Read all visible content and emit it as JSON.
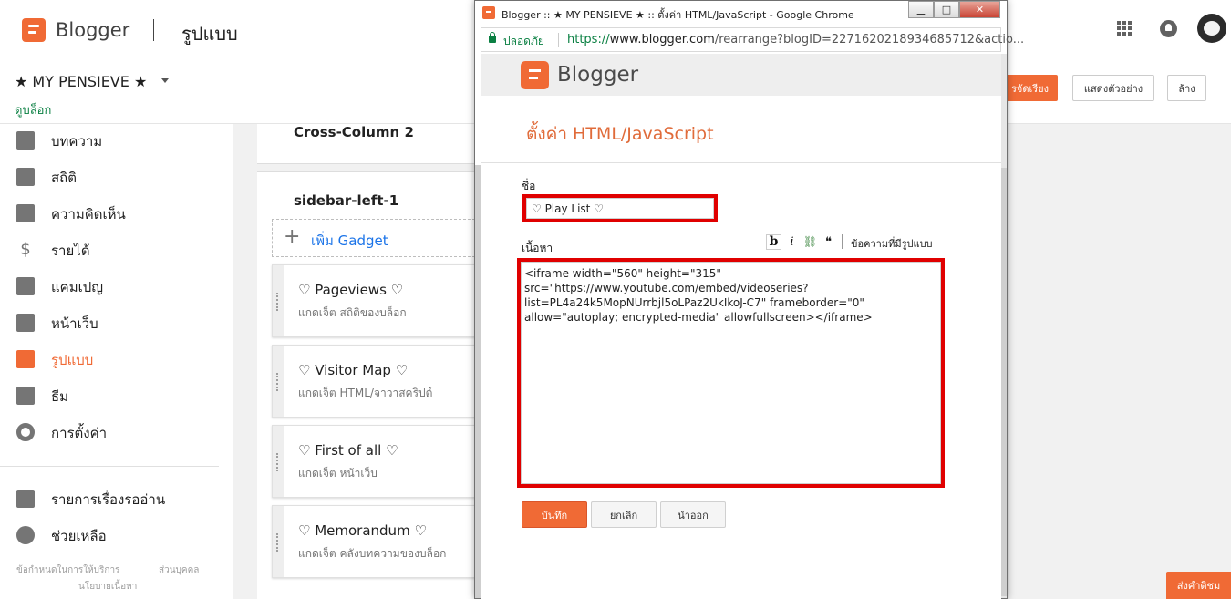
{
  "topbar": {
    "brand": "Blogger",
    "section": "รูปแบบ"
  },
  "blog": {
    "name": "★ MY PENSIEVE ★",
    "view_blog": "ดูบล็อก",
    "arrange_button": "รจัดเรียง",
    "preview_button": "แสดงตัวอย่าง",
    "clear_button": "ล้าง"
  },
  "sidebar": {
    "items": [
      {
        "label": "บทความ",
        "icon": "posts-icon"
      },
      {
        "label": "สถิติ",
        "icon": "stats-icon"
      },
      {
        "label": "ความคิดเห็น",
        "icon": "comments-icon"
      },
      {
        "label": "รายได้",
        "icon": "earnings-icon"
      },
      {
        "label": "แคมเปญ",
        "icon": "campaigns-icon"
      },
      {
        "label": "หน้าเว็บ",
        "icon": "pages-icon"
      },
      {
        "label": "รูปแบบ",
        "icon": "layout-icon"
      },
      {
        "label": "ธีม",
        "icon": "theme-icon"
      },
      {
        "label": "การตั้งค่า",
        "icon": "settings-icon"
      }
    ],
    "reading_list": "รายการเรื่องรออ่าน",
    "help": "ช่วยเหลือ",
    "footer": {
      "terms": "ข้อกำหนดในการให้บริการ",
      "privacy": "ส่วนบุคคล",
      "content_policy": "นโยบายเนื้อหา"
    }
  },
  "layout": {
    "cross_column": "Cross-Column 2",
    "section_title": "sidebar-left-1",
    "add_gadget": "เพิ่ม Gadget",
    "gadgets": [
      {
        "title": "♡ Pageviews ♡",
        "subtitle": "แกดเจ็ต สถิติของบล็อก"
      },
      {
        "title": "♡ Visitor Map ♡",
        "subtitle": "แกดเจ็ต HTML/จาวาสคริปต์"
      },
      {
        "title": "♡ First of all ♡",
        "subtitle": "แกดเจ็ต หน้าเว็บ"
      },
      {
        "title": "♡ Memorandum ♡",
        "subtitle": "แกดเจ็ต คลังบทความของบล็อก"
      }
    ]
  },
  "popup": {
    "window_title": "Blogger :: ★ MY PENSIEVE ★ :: ตั้งค่า HTML/JavaScript - Google Chrome",
    "secure_label": "ปลอดภัย",
    "url_scheme": "https://",
    "url_host": "www.blogger.com",
    "url_rest": "/rearrange?blogID=2271620218934685712&actio...",
    "brand": "Blogger",
    "heading": "ตั้งค่า HTML/JavaScript",
    "name_label": "ชื่อ",
    "name_value": "♡ Play List ♡",
    "content_label": "เนื้อหา",
    "rich_text_link": "ข้อความที่มีรูปแบบ",
    "content_value": "<iframe width=\"560\" height=\"315\"\nsrc=\"https://www.youtube.com/embed/videoseries?\nlist=PL4a24k5MopNUrrbjl5oLPaz2UkIkoJ-C7\" frameborder=\"0\"\nallow=\"autoplay; encrypted-media\" allowfullscreen></iframe>",
    "save_button": "บันทึก",
    "cancel_button": "ยกเลิก",
    "remove_button": "นำออก",
    "toolbar": {
      "bold": "b",
      "italic": "i",
      "quote": "❝"
    }
  },
  "feedback_button": "ส่งคำติชม",
  "colors": {
    "brand_orange": "#f06a35",
    "highlight_red": "#e00000",
    "link_green": "#0b8043"
  }
}
